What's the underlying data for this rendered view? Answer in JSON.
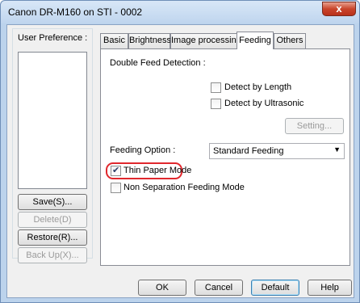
{
  "window": {
    "title": "Canon DR-M160 on STI - 0002",
    "close_glyph": "x"
  },
  "user_preference": {
    "label": "User Preference :",
    "buttons": {
      "save": "Save(S)...",
      "delete": "Delete(D)",
      "restore": "Restore(R)...",
      "backup": "Back Up(X)..."
    }
  },
  "tabs": [
    {
      "label": "Basic"
    },
    {
      "label": "Brightness"
    },
    {
      "label": "Image processing"
    },
    {
      "label": "Feeding"
    },
    {
      "label": "Others"
    }
  ],
  "feeding": {
    "double_feed_label": "Double Feed Detection :",
    "detect_by_length": {
      "label": "Detect by Length",
      "checked": false
    },
    "detect_by_ultrasonic": {
      "label": "Detect by Ultrasonic",
      "checked": false
    },
    "setting_button": "Setting...",
    "feeding_option_label": "Feeding Option :",
    "feeding_option_value": "Standard Feeding",
    "thin_paper_mode": {
      "label": "Thin Paper Mode",
      "checked": true
    },
    "non_separation": {
      "label": "Non Separation Feeding Mode",
      "checked": false
    }
  },
  "footer": {
    "ok": "OK",
    "cancel": "Cancel",
    "default": "Default",
    "help": "Help"
  },
  "colors": {
    "highlight": "#e0282d",
    "title_bar": "#bfd5ee",
    "close_button": "#c9452b"
  }
}
